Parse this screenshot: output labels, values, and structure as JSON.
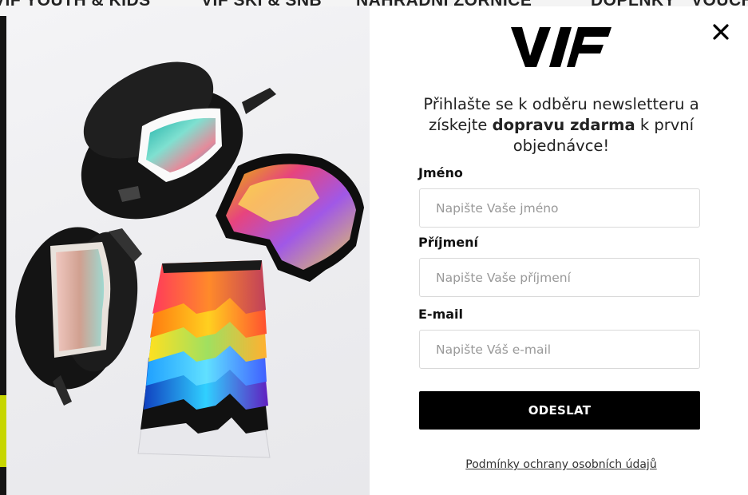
{
  "background_nav": {
    "items": [
      "VIF YOUTH & KIDS",
      "VIF SKI & SNB",
      "NÁHRADNÍ ZORNICE",
      "DOPLŇKY",
      "VOUCHERY"
    ]
  },
  "modal": {
    "logo_text": "VIF",
    "close_icon": "close-icon",
    "headline_part1": "Přihlašte se k odběru newsletteru a získejte ",
    "headline_bold": "dopravu zdarma",
    "headline_part2": " k první objednávce!",
    "fields": {
      "first_name": {
        "label": "Jméno",
        "placeholder": "Napište Vaše jméno",
        "value": ""
      },
      "last_name": {
        "label": "Příjmení",
        "placeholder": "Napište Vaše příjmení",
        "value": ""
      },
      "email": {
        "label": "E-mail",
        "placeholder": "Napište Váš e-mail",
        "value": ""
      }
    },
    "submit_label": "ODESLAT",
    "privacy_link": "Podmínky ochrany osobních údajů"
  },
  "colors": {
    "accent": "#000000",
    "modal_bg": "#ffffff",
    "overlay": "#2a2a2a",
    "accent_lime": "#c7d600"
  }
}
